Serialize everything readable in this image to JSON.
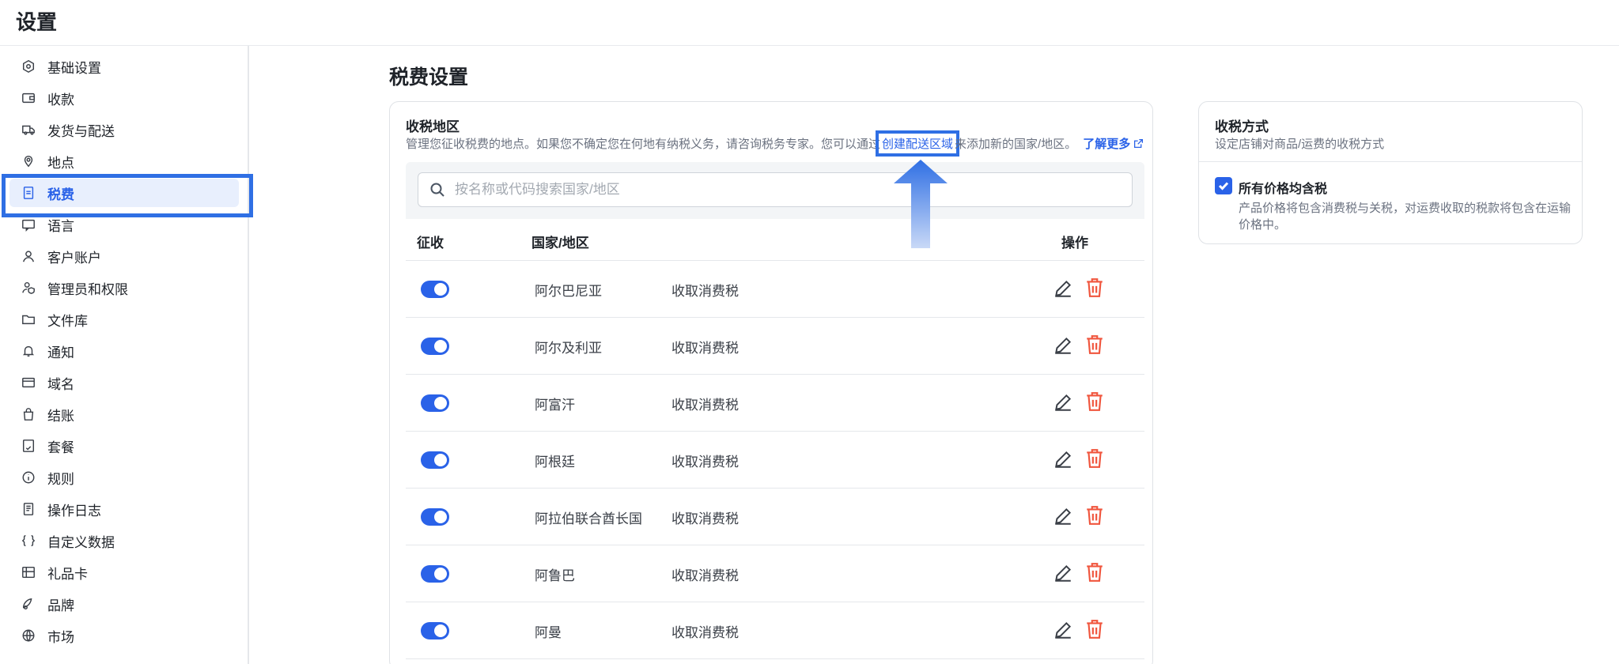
{
  "topbar": {
    "title": "设置"
  },
  "sidebar": {
    "items": [
      {
        "label": "基础设置",
        "icon": "gear-hex-icon"
      },
      {
        "label": "收款",
        "icon": "wallet-icon"
      },
      {
        "label": "发货与配送",
        "icon": "truck-icon"
      },
      {
        "label": "地点",
        "icon": "location-pin-icon"
      },
      {
        "label": "税费",
        "icon": "tax-document-icon",
        "active": true
      },
      {
        "label": "语言",
        "icon": "language-icon"
      },
      {
        "label": "客户账户",
        "icon": "user-icon"
      },
      {
        "label": "管理员和权限",
        "icon": "user-shield-icon"
      },
      {
        "label": "文件库",
        "icon": "folder-icon"
      },
      {
        "label": "通知",
        "icon": "bell-icon"
      },
      {
        "label": "域名",
        "icon": "domain-icon"
      },
      {
        "label": "结账",
        "icon": "shopping-bag-icon"
      },
      {
        "label": "套餐",
        "icon": "plan-icon"
      },
      {
        "label": "规则",
        "icon": "info-circle-icon"
      },
      {
        "label": "操作日志",
        "icon": "log-icon"
      },
      {
        "label": "自定义数据",
        "icon": "code-braces-icon"
      },
      {
        "label": "礼品卡",
        "icon": "gift-card-icon"
      },
      {
        "label": "品牌",
        "icon": "brand-icon"
      },
      {
        "label": "市场",
        "icon": "globe-icon"
      }
    ]
  },
  "main": {
    "title": "税费设置",
    "regions": {
      "title": "收税地区",
      "desc_before": "管理您征收税费的地点。如果您不确定您在何地有纳税义务，请咨询税务专家。您可以通过",
      "create_link": "创建配送区域",
      "desc_after": "来添加新的国家/地区。",
      "learn_more": "了解更多",
      "search_placeholder": "按名称或代码搜索国家/地区",
      "columns": {
        "collect": "征收",
        "country": "国家/地区",
        "actions": "操作"
      },
      "rows": [
        {
          "country": "阿尔巴尼亚",
          "rule": "收取消费税",
          "enabled": true
        },
        {
          "country": "阿尔及利亚",
          "rule": "收取消费税",
          "enabled": true
        },
        {
          "country": "阿富汗",
          "rule": "收取消费税",
          "enabled": true
        },
        {
          "country": "阿根廷",
          "rule": "收取消费税",
          "enabled": true
        },
        {
          "country": "阿拉伯联合酋长国",
          "rule": "收取消费税",
          "enabled": true
        },
        {
          "country": "阿鲁巴",
          "rule": "收取消费税",
          "enabled": true
        },
        {
          "country": "阿曼",
          "rule": "收取消费税",
          "enabled": true
        }
      ]
    },
    "tax_method": {
      "title": "收税方式",
      "desc": "设定店铺对商品/运费的收税方式",
      "checkbox_label": "所有价格均含税",
      "checkbox_checked": true,
      "checkbox_help": "产品价格将包含消费税与关税，对运费收取的税款将包含在运输价格中。"
    }
  },
  "colors": {
    "accent": "#2a62e8",
    "highlight": "#2f6fe4",
    "delete": "#f0553d"
  }
}
